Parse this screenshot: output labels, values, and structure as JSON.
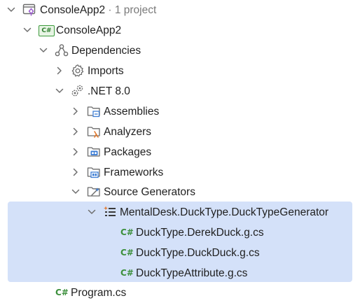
{
  "solution": {
    "name": "ConsoleApp2",
    "meta": " · 1 project",
    "icon": "solution-icon"
  },
  "project": {
    "name": "ConsoleApp2",
    "badge": "C#",
    "icon": "csharp-project-icon"
  },
  "dependencies": {
    "label": "Dependencies",
    "icon": "dependencies-icon"
  },
  "imports": {
    "label": "Imports",
    "icon": "gear-icon"
  },
  "framework": {
    "label": ".NET 8.0",
    "icon": "dotnet-gears-icon"
  },
  "folders": [
    {
      "label": "Assemblies",
      "icon": "assemblies-folder-icon"
    },
    {
      "label": "Analyzers",
      "icon": "analyzers-folder-icon"
    },
    {
      "label": "Packages",
      "icon": "packages-folder-icon"
    },
    {
      "label": "Frameworks",
      "icon": "frameworks-folder-icon"
    },
    {
      "label": "Source Generators",
      "icon": "source-generators-folder-icon"
    }
  ],
  "generator": {
    "label": "MentalDesk.DuckType.DuckTypeGenerator",
    "icon": "generator-icon"
  },
  "generated_files": [
    {
      "badge": "C#",
      "label": "DuckType.DerekDuck.g.cs"
    },
    {
      "badge": "C#",
      "label": "DuckType.DuckDuck.g.cs"
    },
    {
      "badge": "C#",
      "label": "DuckTypeAttribute.g.cs"
    }
  ],
  "program_file": {
    "badge": "C#",
    "label": "Program.cs"
  },
  "colors": {
    "selection": "#d4e1f9",
    "csharp_green": "#3c8f3c",
    "folder_blue": "#3f7fd6"
  }
}
